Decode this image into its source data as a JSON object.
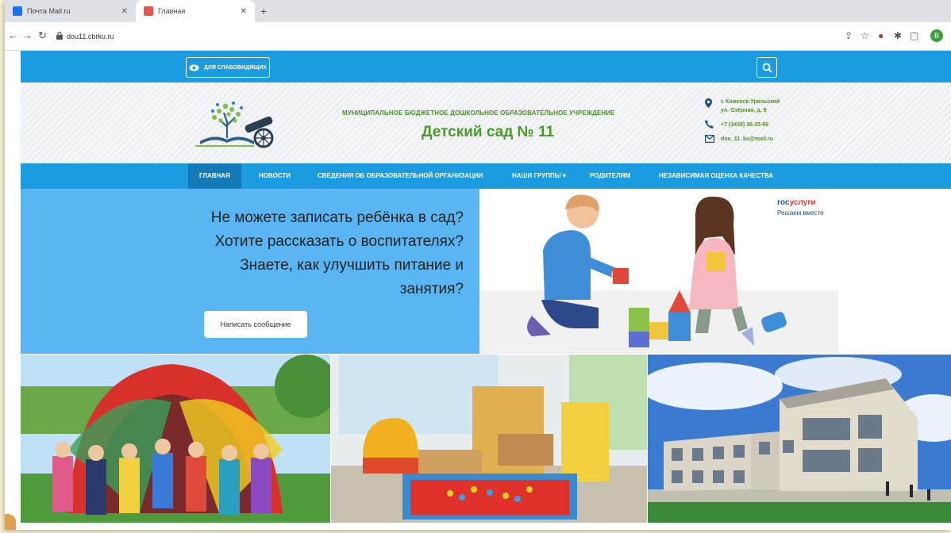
{
  "browser": {
    "tabs": [
      {
        "label": "Почта Mail.ru"
      },
      {
        "label": "Главная"
      }
    ],
    "new_tab": "+",
    "url": "dou11.cbrku.ru",
    "profile_initial": "B"
  },
  "topbar": {
    "vision_label": "ДЛЯ СЛАБОВИДЯЩИХ"
  },
  "header": {
    "org_subtitle": "МУНИЦИПАЛЬНОЕ БЮДЖЕТНОЕ ДОШКОЛЬНОЕ ОБРАЗОВАТЕЛЬНОЕ УЧРЕЖДЕНИЕ",
    "org_title": "Детский сад № 11",
    "address_line1": "г. Каменск-Уральский",
    "address_line2": "ул. Озёрная, д. 9",
    "phone": "+7 (3439) 36-35-66",
    "email": "dou_11_ku@mail.ru"
  },
  "nav": {
    "items": [
      {
        "label": "ГЛАВНАЯ"
      },
      {
        "label": "НОВОСТИ"
      },
      {
        "label": "СВЕДЕНИЯ ОБ ОБРАЗОВАТЕЛЬНОЙ ОРГАНИЗАЦИИ"
      },
      {
        "label": "НАШИ ГРУППЫ ▾"
      },
      {
        "label": "РОДИТЕЛЯМ"
      },
      {
        "label": "НЕЗАВИСИМАЯ ОЦЕНКА КАЧЕСТВА"
      }
    ]
  },
  "banner": {
    "text": "Не можете записать ребёнка в сад? Хотите рассказать о воспитателях? Знаете, как улучшить питание и занятия?",
    "button_label": "Написать сообщение",
    "gos_part1": "гос",
    "gos_part2": "услуги",
    "gos_sub": "Решаем вместе"
  },
  "colors": {
    "primary_blue": "#1b9be0",
    "active_nav": "#157bb8",
    "banner_blue": "#5ab6f2",
    "brand_green": "#4a9a2a"
  }
}
